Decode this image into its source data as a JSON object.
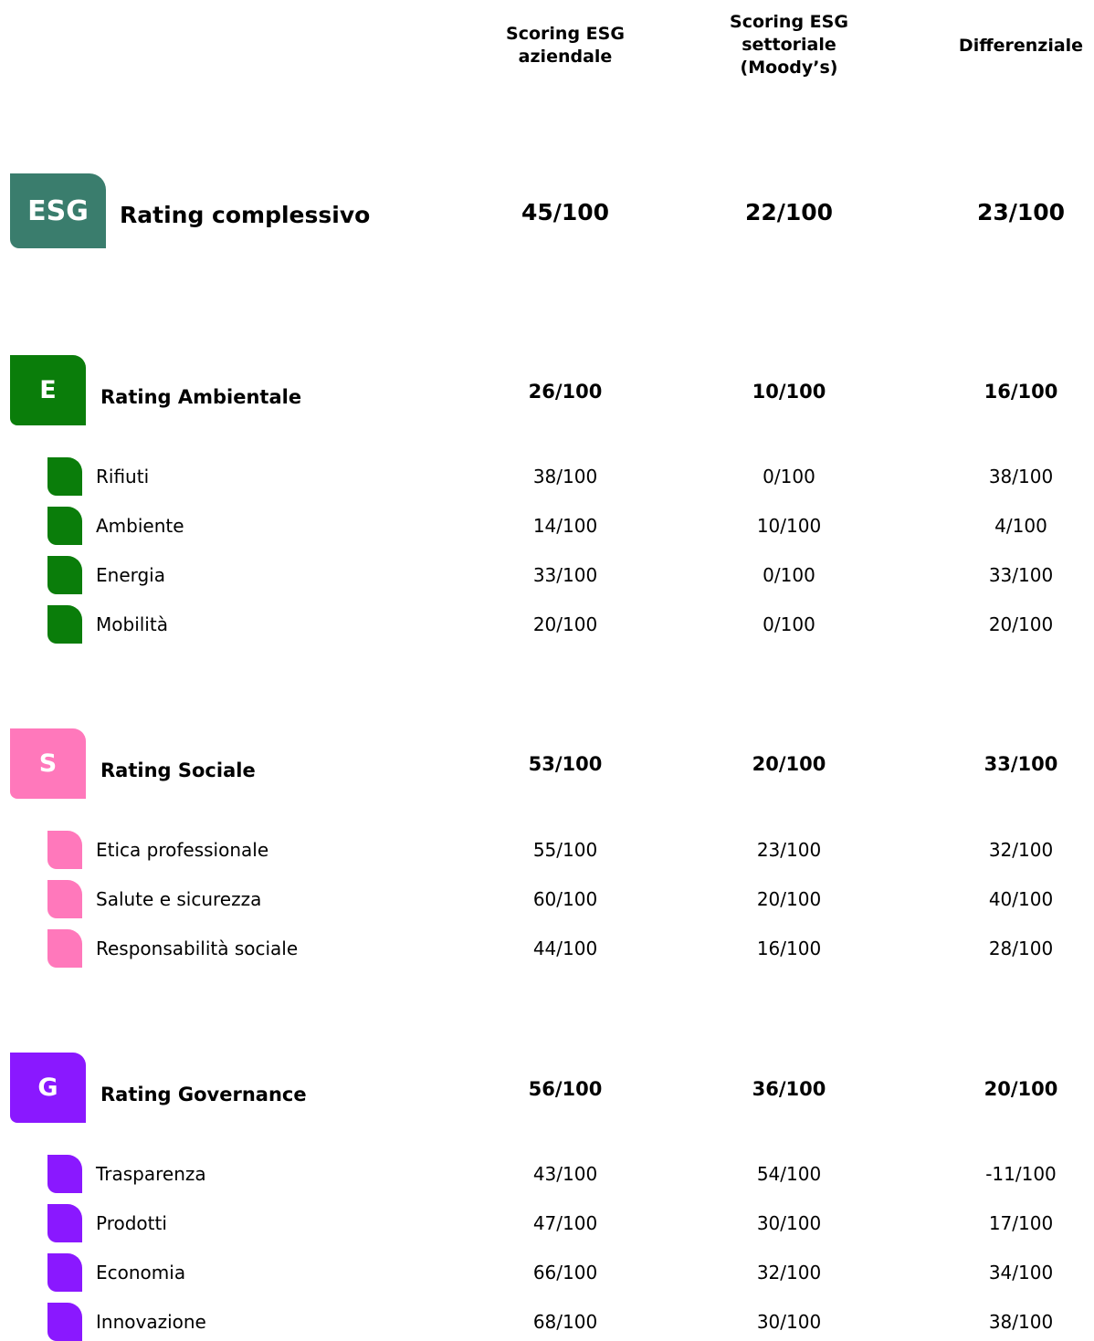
{
  "colors": {
    "esg": "#3a7d6d",
    "environment": "#0a7d0a",
    "social": "#ff78bb",
    "governance": "#8a18ff"
  },
  "headers": {
    "col1": "Scoring ESG aziendale",
    "col2": "Scoring ESG settoriale (Moody’s)",
    "col3": "Differenziale"
  },
  "overall": {
    "badge": "ESG",
    "label": "Rating complessivo",
    "values": [
      "45/100",
      "22/100",
      "23/100"
    ]
  },
  "environment": {
    "badge": "E",
    "label": "Rating Ambientale",
    "values": [
      "26/100",
      "10/100",
      "16/100"
    ],
    "items": [
      {
        "label": "Rifiuti",
        "values": [
          "38/100",
          "0/100",
          "38/100"
        ]
      },
      {
        "label": "Ambiente",
        "values": [
          "14/100",
          "10/100",
          "4/100"
        ]
      },
      {
        "label": "Energia",
        "values": [
          "33/100",
          "0/100",
          "33/100"
        ]
      },
      {
        "label": "Mobilità",
        "values": [
          "20/100",
          "0/100",
          "20/100"
        ]
      }
    ]
  },
  "social": {
    "badge": "S",
    "label": "Rating Sociale",
    "values": [
      "53/100",
      "20/100",
      "33/100"
    ],
    "items": [
      {
        "label": "Etica professionale",
        "values": [
          "55/100",
          "23/100",
          "32/100"
        ]
      },
      {
        "label": "Salute e sicurezza",
        "values": [
          "60/100",
          "20/100",
          "40/100"
        ]
      },
      {
        "label": "Responsabilità sociale",
        "values": [
          "44/100",
          "16/100",
          "28/100"
        ]
      }
    ]
  },
  "governance": {
    "badge": "G",
    "label": "Rating Governance",
    "values": [
      "56/100",
      "36/100",
      "20/100"
    ],
    "items": [
      {
        "label": "Trasparenza",
        "values": [
          "43/100",
          "54/100",
          "-11/100"
        ]
      },
      {
        "label": "Prodotti",
        "values": [
          "47/100",
          "30/100",
          "17/100"
        ]
      },
      {
        "label": "Economia",
        "values": [
          "66/100",
          "32/100",
          "34/100"
        ]
      },
      {
        "label": "Innovazione",
        "values": [
          "68/100",
          "30/100",
          "38/100"
        ]
      }
    ]
  }
}
